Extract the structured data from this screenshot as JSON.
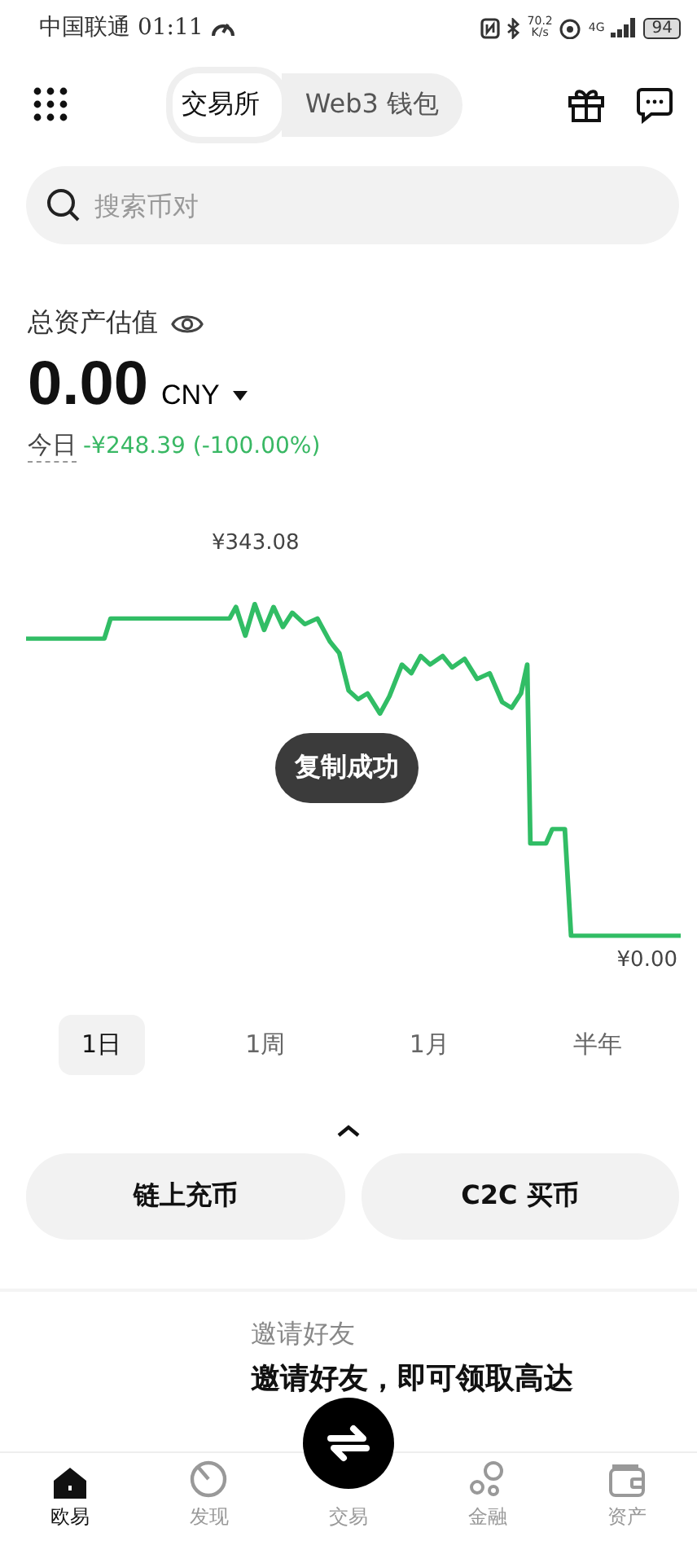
{
  "status_bar": {
    "carrier": "中国联通",
    "time": "01:11",
    "net_speed": "70.2\nK/s",
    "network": "4G",
    "battery": "94"
  },
  "header": {
    "tabs": [
      {
        "label": "交易所",
        "selected": true
      },
      {
        "label": "Web3 钱包",
        "selected": false
      }
    ]
  },
  "search": {
    "placeholder": "搜索币对"
  },
  "assets": {
    "label": "总资产估值",
    "value": "0.00",
    "currency": "CNY",
    "today_label": "今日",
    "today_change": "-¥248.39 (-100.00%)"
  },
  "chart": {
    "high_label": "¥343.08",
    "low_label": "¥0.00"
  },
  "toast": "复制成功",
  "periods": [
    {
      "label": "1日",
      "selected": true
    },
    {
      "label": "1周",
      "selected": false
    },
    {
      "label": "1月",
      "selected": false
    },
    {
      "label": "半年",
      "selected": false
    }
  ],
  "actions": [
    "链上充币",
    "C2C 买币"
  ],
  "invite": {
    "title": "邀请好友",
    "text": "邀请好友，即可领取高达"
  },
  "nav": [
    {
      "label": "欧易",
      "selected": true,
      "kind": "home"
    },
    {
      "label": "发现",
      "selected": false,
      "kind": "discover"
    },
    {
      "label": "交易",
      "selected": false,
      "kind": "trade"
    },
    {
      "label": "金融",
      "selected": false,
      "kind": "finance"
    },
    {
      "label": "资产",
      "selected": false,
      "kind": "wallet"
    }
  ]
}
